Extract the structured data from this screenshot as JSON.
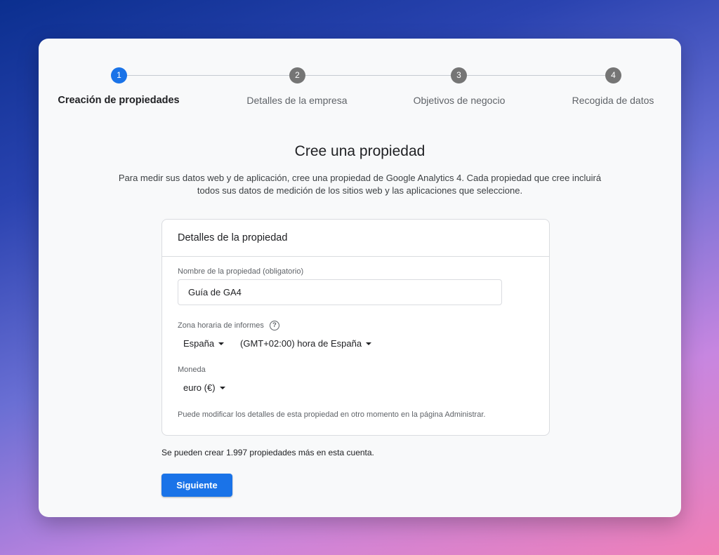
{
  "stepper": {
    "steps": [
      {
        "number": "1",
        "label": "Creación de propiedades",
        "active": true
      },
      {
        "number": "2",
        "label": "Detalles de la empresa",
        "active": false
      },
      {
        "number": "3",
        "label": "Objetivos de negocio",
        "active": false
      },
      {
        "number": "4",
        "label": "Recogida de datos",
        "active": false
      }
    ]
  },
  "main": {
    "title": "Cree una propiedad",
    "intro_line1": "Para medir sus datos web y de aplicación, cree una propiedad de Google Analytics 4. Cada propiedad que cree incluirá",
    "intro_line2": "todos sus datos de medición de los sitios web y las aplicaciones que seleccione."
  },
  "card": {
    "header": "Detalles de la propiedad",
    "name_label": "Nombre de la propiedad (obligatorio)",
    "name_value": "Guía de GA4",
    "timezone_label": "Zona horaria de informes",
    "help_icon": "?",
    "country_value": "España",
    "timezone_value": "(GMT+02:00) hora de España",
    "currency_label": "Moneda",
    "currency_value": "euro (€)",
    "note": "Puede modificar los detalles de esta propiedad en otro momento en la página Administrar."
  },
  "footer": {
    "remaining": "Se pueden crear 1.997 propiedades más en esta cuenta.",
    "next_label": "Siguiente"
  },
  "colors": {
    "accent": "#1a73e8",
    "inactive_step": "#757575"
  }
}
